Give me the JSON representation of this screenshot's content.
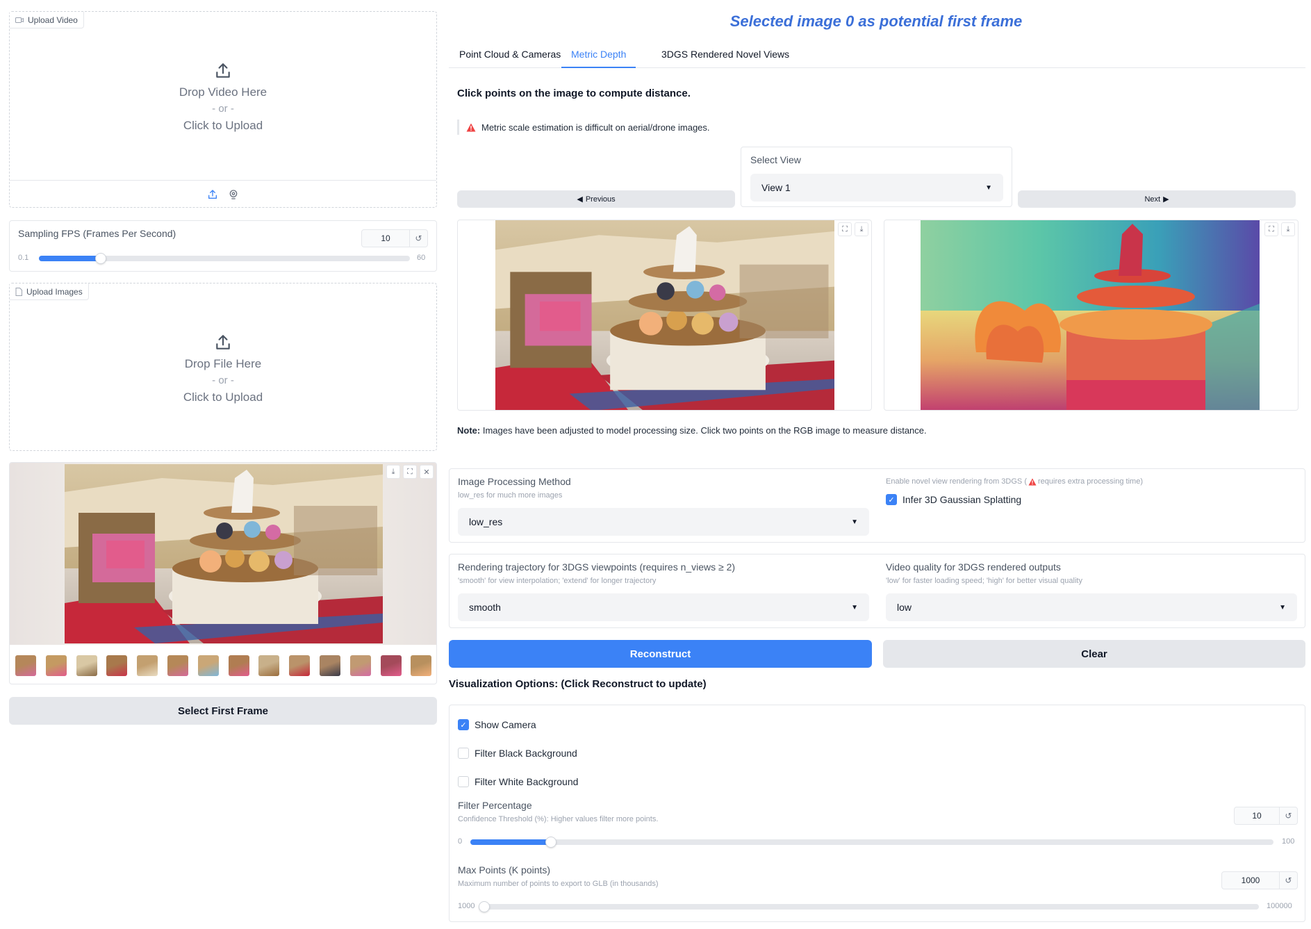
{
  "upload_video": {
    "tag_label": "Upload Video",
    "drop_text": "Drop Video Here",
    "or_text": "- or -",
    "click_text": "Click to Upload"
  },
  "sampling_fps": {
    "label": "Sampling FPS (Frames Per Second)",
    "value": "10",
    "min": "0.1",
    "max": "60",
    "fraction": 0.166
  },
  "upload_images": {
    "tag_label": "Upload Images",
    "drop_text": "Drop File Here",
    "or_text": "- or -",
    "click_text": "Click to Upload"
  },
  "gallery": {
    "thumbnail_count": 14
  },
  "select_first_frame_label": "Select First Frame",
  "header": {
    "title": "Selected image 0 as potential first frame",
    "title_color": "#3b6fd8"
  },
  "tabs": [
    {
      "label": "Point Cloud & Cameras",
      "active": false
    },
    {
      "label": "Metric Depth",
      "active": true
    },
    {
      "label": "3DGS Rendered Novel Views",
      "active": false
    }
  ],
  "metric_depth": {
    "instruction": "Click points on the image to compute distance.",
    "warning": "Metric scale estimation is difficult on aerial/drone images.",
    "select_view_label": "Select View",
    "select_view_value": "View 1",
    "previous_label": "Previous",
    "next_label": "Next",
    "note_bold": "Note:",
    "note_text": " Images have been adjusted to model processing size. Click two points on the RGB image to measure distance."
  },
  "processing": {
    "method_label": "Image Processing Method",
    "method_info": "low_res for much more images",
    "method_value": "low_res",
    "novel_info_prefix": "Enable novel view rendering from 3DGS (",
    "novel_info_warn": "requires extra processing time)",
    "gs_label": "Infer 3D Gaussian Splatting",
    "gs_checked": true,
    "traj_label": "Rendering trajectory for 3DGS viewpoints (requires n_views ≥ 2)",
    "traj_info": "'smooth' for view interpolation; 'extend' for longer trajectory",
    "traj_value": "smooth",
    "quality_label": "Video quality for 3DGS rendered outputs",
    "quality_info": "'low' for faster loading speed; 'high' for better visual quality",
    "quality_value": "low"
  },
  "actions": {
    "reconstruct_label": "Reconstruct",
    "clear_label": "Clear",
    "primary_color": "#3b82f6"
  },
  "visualization": {
    "heading": "Visualization Options: (Click Reconstruct to update)",
    "show_camera_label": "Show Camera",
    "show_camera_checked": true,
    "filter_black_label": "Filter Black Background",
    "filter_black_checked": false,
    "filter_white_label": "Filter White Background",
    "filter_white_checked": false,
    "filter_pct_label": "Filter Percentage",
    "filter_pct_info": "Confidence Threshold (%): Higher values filter more points.",
    "filter_pct_value": "10",
    "filter_pct_min": "0",
    "filter_pct_max": "100",
    "filter_pct_fraction": 0.1,
    "max_points_label": "Max Points (K points)",
    "max_points_info": "Maximum number of points to export to GLB (in thousands)",
    "max_points_value": "1000",
    "max_points_min": "1000",
    "max_points_max": "100000",
    "max_points_fraction": 0.0
  },
  "icons": {
    "upload": "upload-icon",
    "webcam": "webcam-icon",
    "download": "download-icon",
    "fullscreen": "fullscreen-icon",
    "close": "close-icon",
    "reset": "reset-icon",
    "warning": "warning-icon",
    "caret": "chevron-down-icon"
  }
}
